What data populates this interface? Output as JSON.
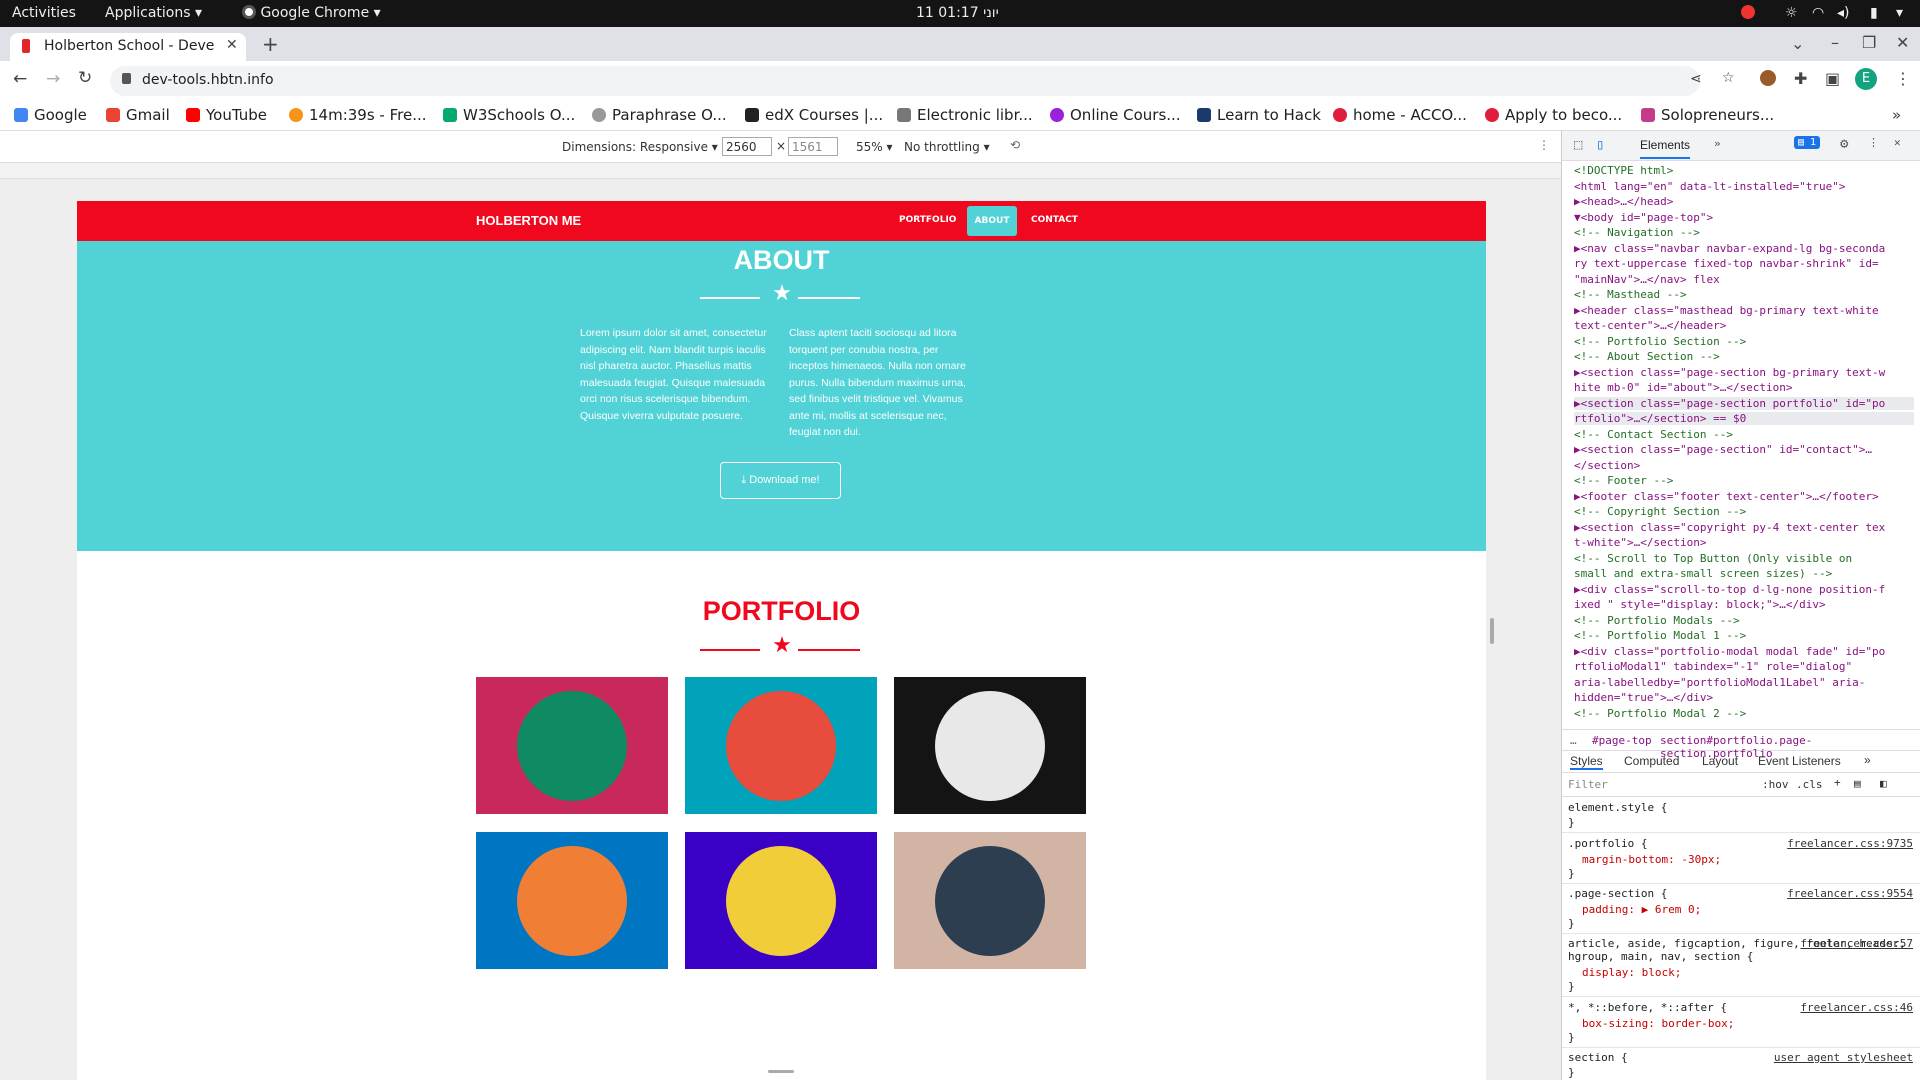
{
  "system_bar": {
    "activities": "Activities",
    "applications": "Applications",
    "browser": "Google Chrome",
    "clock": "11 יוני 01:17"
  },
  "chrome": {
    "tab_title": "Holberton School - Deve",
    "url": "dev-tools.hbtn.info",
    "profile_initial": "E",
    "bookmarks": [
      "Google",
      "Gmail",
      "YouTube",
      "14m:39s - Fre...",
      "W3Schools O...",
      "Paraphrase O...",
      "edX Courses |...",
      "Electronic libr...",
      "Online Cours...",
      "Learn to Hack",
      "home - ACCO...",
      "Apply to beco...",
      "Solopreneurs..."
    ]
  },
  "device_toolbar": {
    "dimensions_label": "Dimensions: Responsive",
    "width": "2560",
    "height": "1561",
    "zoom": "55%",
    "throttling": "No throttling"
  },
  "site": {
    "brand": "HOLBERTON ME",
    "nav": [
      "PORTFOLIO",
      "ABOUT",
      "CONTACT"
    ],
    "about_title": "ABOUT",
    "about_left": "Lorem ipsum dolor sit amet, consectetur adipiscing elit. Nam blandit turpis iaculis nisl pharetra auctor. Phasellus mattis malesuada feugiat. Quisque malesuada orci non risus scelerisque bibendum. Quisque viverra vulputate posuere.",
    "about_right": "Class aptent taciti sociosqu ad litora torquent per conubia nostra, per inceptos himenaeos. Nulla non ornare purus. Nulla bibendum maximus urna, sed finibus velit tristique vel. Vivamus ante mi, mollis at scelerisque nec, feugiat non dui.",
    "download_label": "Download me!",
    "portfolio_title": "PORTFOLIO",
    "tiles": [
      {
        "icon": "cabin-icon",
        "bg": "#c9295a",
        "circle": "#0f8a63"
      },
      {
        "icon": "cake-icon",
        "bg": "#00a3b9",
        "circle": "#e74c3c"
      },
      {
        "icon": "circus-icon",
        "bg": "#141414",
        "circle": "#e8e8e8"
      },
      {
        "icon": "gamepad-icon",
        "bg": "#0075c2",
        "circle": "#f07f35"
      },
      {
        "icon": "safe-icon",
        "bg": "#3b00c6",
        "circle": "#f2cd3a"
      },
      {
        "icon": "submarine-icon",
        "bg": "#d2b4a5",
        "circle": "#2c3e50"
      }
    ]
  },
  "devtools": {
    "tabs": [
      "Elements"
    ],
    "badge": "1",
    "dom_lines": [
      {
        "t": "<!DOCTYPE html>",
        "c": "cm"
      },
      {
        "t": "<html lang=\"en\" data-lt-installed=\"true\">",
        "c": "tg"
      },
      {
        "t": "▶<head>…</head>",
        "c": "tg"
      },
      {
        "t": "▼<body id=\"page-top\">",
        "c": "tg"
      },
      {
        "t": "  <!-- Navigation -->",
        "c": "cm"
      },
      {
        "t": "▶<nav class=\"navbar navbar-expand-lg bg-seconda",
        "c": "tg"
      },
      {
        "t": "  ry text-uppercase fixed-top navbar-shrink\" id=",
        "c": "tg"
      },
      {
        "t": "  \"mainNav\">…</nav> flex",
        "c": "tg"
      },
      {
        "t": "  <!-- Masthead -->",
        "c": "cm"
      },
      {
        "t": "▶<header class=\"masthead bg-primary text-white",
        "c": "tg"
      },
      {
        "t": "  text-center\">…</header>",
        "c": "tg"
      },
      {
        "t": "  <!-- Portfolio Section -->",
        "c": "cm"
      },
      {
        "t": "  <!-- About Section -->",
        "c": "cm"
      },
      {
        "t": "▶<section class=\"page-section bg-primary text-w",
        "c": "tg"
      },
      {
        "t": "  hite mb-0\" id=\"about\">…</section>",
        "c": "tg"
      },
      {
        "t": "▶<section class=\"page-section portfolio\" id=\"po",
        "c": "tg"
      },
      {
        "t": "  rtfolio\">…</section> == $0",
        "c": "tg"
      },
      {
        "t": "  <!-- Contact Section -->",
        "c": "cm"
      },
      {
        "t": "▶<section class=\"page-section\" id=\"contact\">…",
        "c": "tg"
      },
      {
        "t": "  </section>",
        "c": "tg"
      },
      {
        "t": "  <!-- Footer -->",
        "c": "cm"
      },
      {
        "t": "▶<footer class=\"footer text-center\">…</footer>",
        "c": "tg"
      },
      {
        "t": "  <!-- Copyright Section -->",
        "c": "cm"
      },
      {
        "t": "▶<section class=\"copyright py-4 text-center tex",
        "c": "tg"
      },
      {
        "t": "  t-white\">…</section>",
        "c": "tg"
      },
      {
        "t": "  <!-- Scroll to Top Button (Only visible on",
        "c": "cm"
      },
      {
        "t": "  small and extra-small screen sizes) -->",
        "c": "cm"
      },
      {
        "t": "▶<div class=\"scroll-to-top d-lg-none position-f",
        "c": "tg"
      },
      {
        "t": "  ixed \" style=\"display: block;\">…</div>",
        "c": "tg"
      },
      {
        "t": "  <!-- Portfolio Modals -->",
        "c": "cm"
      },
      {
        "t": "  <!-- Portfolio Modal 1 -->",
        "c": "cm"
      },
      {
        "t": "▶<div class=\"portfolio-modal modal fade\" id=\"po",
        "c": "tg"
      },
      {
        "t": "  rtfolioModal1\" tabindex=\"-1\" role=\"dialog\"",
        "c": "tg"
      },
      {
        "t": "  aria-labelledby=\"portfolioModal1Label\" aria-",
        "c": "tg"
      },
      {
        "t": "  hidden=\"true\">…</div>",
        "c": "tg"
      },
      {
        "t": "  <!-- Portfolio Modal 2 -->",
        "c": "cm"
      }
    ],
    "breadcrumb": [
      "#page-top",
      "section#portfolio.page-section.portfolio"
    ],
    "style_tabs": [
      "Styles",
      "Computed",
      "Layout",
      "Event Listeners"
    ],
    "filter_placeholder": "Filter",
    "filter_buttons": [
      ":hov",
      ".cls"
    ],
    "rules": [
      {
        "sel": "element.style {",
        "decls": [],
        "src": ""
      },
      {
        "sel": ".portfolio {",
        "decls": [
          "margin-bottom: -30px;"
        ],
        "src": "freelancer.css:9735"
      },
      {
        "sel": ".page-section {",
        "decls": [
          "padding: ▶ 6rem 0;"
        ],
        "src": "freelancer.css:9554"
      },
      {
        "sel": "article, aside, figcaption, figure, footer, header, hgroup, main, nav, section {",
        "decls": [
          "display: block;"
        ],
        "src": "freelancer.css:57"
      },
      {
        "sel": "*, *::before, *::after {",
        "decls": [
          "box-sizing: border-box;"
        ],
        "src": "freelancer.css:46"
      },
      {
        "sel": "section {",
        "decls": [],
        "src": "user agent stylesheet"
      }
    ]
  }
}
